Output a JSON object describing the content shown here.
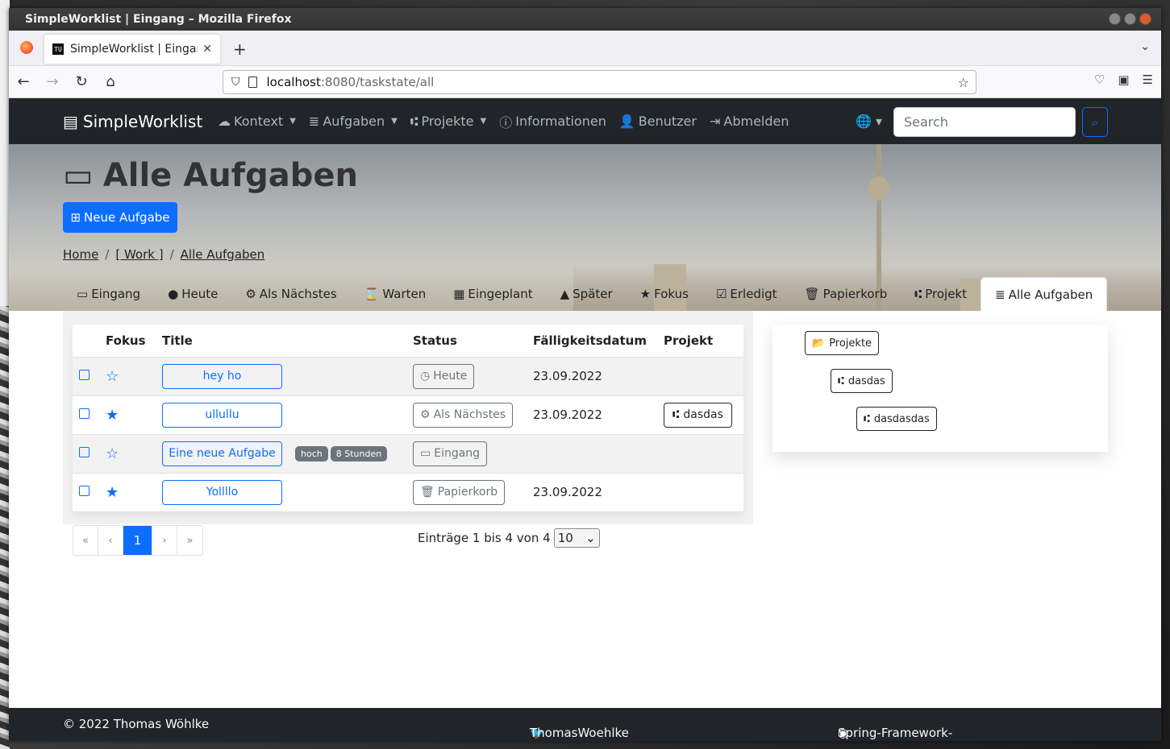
{
  "window": {
    "title": "SimpleWorklist | Eingang – Mozilla Firefox"
  },
  "browser": {
    "tab_title": "SimpleWorklist | Eingang",
    "favicon_text": "TU",
    "url_host": "localhost",
    "url_path": ":8080/taskstate/all"
  },
  "app": {
    "brand": "SimpleWorklist",
    "menu": [
      {
        "label": "Kontext",
        "icon": "cloud-icon",
        "dropdown": true
      },
      {
        "label": "Aufgaben",
        "icon": "database-icon",
        "dropdown": true
      },
      {
        "label": "Projekte",
        "icon": "project-diagram-icon",
        "dropdown": true
      },
      {
        "label": "Informationen",
        "icon": "info-circle-icon",
        "dropdown": false
      },
      {
        "label": "Benutzer",
        "icon": "user-icon",
        "dropdown": false
      },
      {
        "label": "Abmelden",
        "icon": "sign-out-icon",
        "dropdown": false
      }
    ],
    "search_placeholder": "Search"
  },
  "hero": {
    "title": "Alle Aufgaben",
    "new_task": "Neue Aufgabe",
    "breadcrumb": [
      "Home",
      "[ Work ]",
      "Alle Aufgaben"
    ],
    "tabs": [
      {
        "label": "Eingang",
        "icon": "inbox-icon"
      },
      {
        "label": "Heute",
        "icon": "clock-icon"
      },
      {
        "label": "Als Nächstes",
        "icon": "cogs-icon"
      },
      {
        "label": "Warten",
        "icon": "hourglass-icon"
      },
      {
        "label": "Eingeplant",
        "icon": "calendar-icon"
      },
      {
        "label": "Später",
        "icon": "road-icon"
      },
      {
        "label": "Fokus",
        "icon": "star-icon"
      },
      {
        "label": "Erledigt",
        "icon": "check-square-icon"
      },
      {
        "label": "Papierkorb",
        "icon": "trash-icon"
      },
      {
        "label": "Projekt",
        "icon": "project-diagram-icon"
      },
      {
        "label": "Alle Aufgaben",
        "icon": "database-icon",
        "active": true
      }
    ]
  },
  "table": {
    "headers": [
      "",
      "Fokus",
      "Title",
      "",
      "Status",
      "Fälligkeitsdatum",
      "Projekt"
    ],
    "rows": [
      {
        "focus": false,
        "title": "hey ho",
        "badges": [],
        "status": "Heute",
        "status_icon": "clock-icon",
        "due": "23.09.2022",
        "project": ""
      },
      {
        "focus": true,
        "title": "ullullu",
        "badges": [],
        "status": "Als Nächstes",
        "status_icon": "cogs-icon",
        "due": "23.09.2022",
        "project": "dasdas"
      },
      {
        "focus": false,
        "title": "Eine neue Aufgabe",
        "badges": [
          "hoch",
          "8 Stunden"
        ],
        "status": "Eingang",
        "status_icon": "inbox-icon",
        "due": "",
        "project": ""
      },
      {
        "focus": true,
        "title": "Yollllo",
        "badges": [],
        "status": "Papierkorb",
        "status_icon": "trash-icon",
        "due": "23.09.2022",
        "project": ""
      }
    ]
  },
  "pagination": {
    "first": "«",
    "prev": "‹",
    "current": "1",
    "next": "›",
    "last": "»",
    "entries_text": "Einträge 1 bis 4 von 4",
    "page_size": "10"
  },
  "project_panel": {
    "root": "Projekte",
    "children": [
      "dasdas",
      "dasdasdas"
    ]
  },
  "footer": {
    "copyright": "© 2022 Thomas Wöhlke",
    "twitter": "ThomasWoehlke",
    "github": "Spring-Framework-Java-Apps/simpleworklist"
  },
  "colors": {
    "primary": "#0d6efd",
    "dark": "#212529",
    "secondary": "#6c757d"
  }
}
